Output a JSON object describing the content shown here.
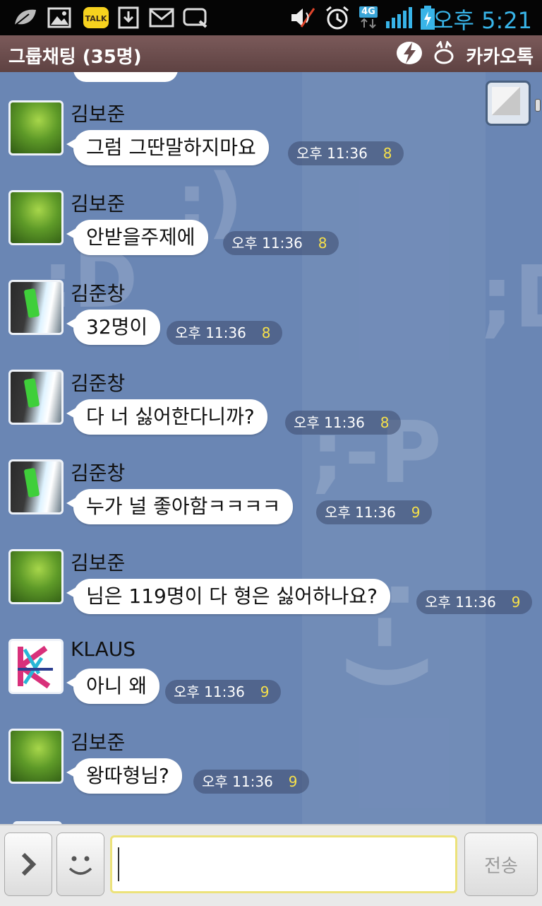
{
  "status_bar": {
    "time": "오후 5:21",
    "network": "4G",
    "icons": [
      "leaf-icon",
      "image-icon",
      "kakaotalk-icon",
      "download-icon",
      "gmail-icon",
      "search-app-icon",
      "mute-icon",
      "alarm-icon",
      "signal-icon",
      "battery-icon"
    ]
  },
  "header": {
    "title": "그룹채팅 (35명)",
    "brand": "카카오톡"
  },
  "messages": [
    {
      "sender": "김보준",
      "text": "그럼 그딴말하지마요",
      "time": "오후 11:36",
      "count": "8",
      "avatar": "green"
    },
    {
      "sender": "김보준",
      "text": "안받을주제에",
      "time": "오후 11:36",
      "count": "8",
      "avatar": "green"
    },
    {
      "sender": "김준창",
      "text": "32명이",
      "time": "오후 11:36",
      "count": "8",
      "avatar": "phone"
    },
    {
      "sender": "김준창",
      "text": "다 너 싫어한다니까?",
      "time": "오후 11:36",
      "count": "8",
      "avatar": "phone"
    },
    {
      "sender": "김준창",
      "text": "누가 널 좋아함ㅋㅋㅋㅋ",
      "time": "오후 11:36",
      "count": "9",
      "avatar": "phone"
    },
    {
      "sender": "김보준",
      "text": "님은 119명이 다 형은 싫어하나요?",
      "time": "오후 11:36",
      "count": "9",
      "avatar": "green"
    },
    {
      "sender": "KLAUS",
      "text": "아니 왜",
      "time": "오후 11:36",
      "count": "9",
      "avatar": "k-logo"
    },
    {
      "sender": "김보준",
      "text": "왕따형님?",
      "time": "오후 11:36",
      "count": "9",
      "avatar": "green"
    }
  ],
  "input": {
    "value": "",
    "send_label": "전송"
  },
  "colors": {
    "chat_bg": "#6a86b4",
    "header_bg": "#6b4d4d",
    "unread_count": "#f6e04a",
    "input_border": "#ece27a"
  }
}
